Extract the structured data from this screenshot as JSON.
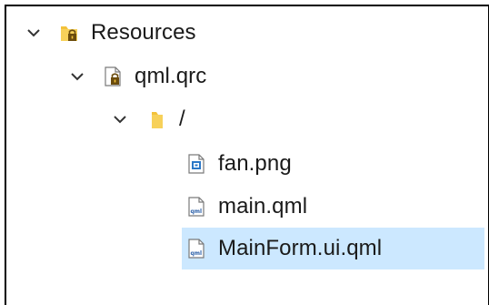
{
  "tree": {
    "items": [
      {
        "label": "Resources",
        "icon": "folder-lock-icon",
        "expanded": true,
        "selected": false
      },
      {
        "label": "qml.qrc",
        "icon": "qrc-file-lock-icon",
        "expanded": true,
        "selected": false
      },
      {
        "label": "/",
        "icon": "folder-icon",
        "expanded": true,
        "selected": false
      },
      {
        "label": "fan.png",
        "icon": "image-file-icon",
        "expanded": null,
        "selected": false
      },
      {
        "label": "main.qml",
        "icon": "qml-file-icon",
        "expanded": null,
        "selected": false
      },
      {
        "label": "MainForm.ui.qml",
        "icon": "qml-file-icon",
        "expanded": null,
        "selected": true
      }
    ]
  },
  "colors": {
    "selection": "#cce8ff",
    "folder": "#f3c23b",
    "lock": "#7a5a12",
    "chevron": "#333333",
    "frame_border": "#000000"
  }
}
